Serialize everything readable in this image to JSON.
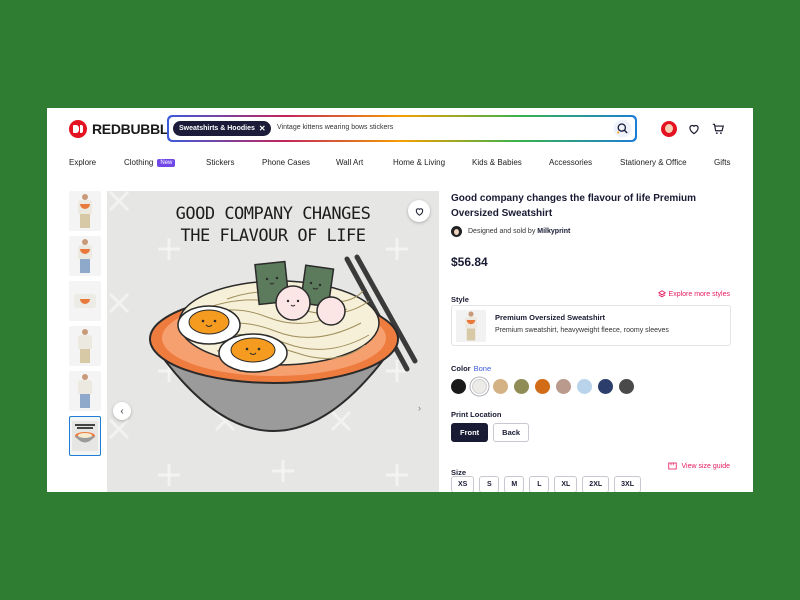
{
  "brand": {
    "name": "REDBUBBLE",
    "accent": "#e41321"
  },
  "search": {
    "chip": "Sweatshirts & Hoodies",
    "chip_clear": "✕",
    "query": "Vintage kittens wearing bows stickers"
  },
  "nav": [
    {
      "label": "Explore"
    },
    {
      "label": "Clothing",
      "badge": "New"
    },
    {
      "label": "Stickers"
    },
    {
      "label": "Phone Cases"
    },
    {
      "label": "Wall Art"
    },
    {
      "label": "Home & Living"
    },
    {
      "label": "Kids & Babies"
    },
    {
      "label": "Accessories"
    },
    {
      "label": "Stationery & Office"
    },
    {
      "label": "Gifts"
    }
  ],
  "gallery": {
    "image_text": [
      "GOOD COMPANY CHANGES",
      "THE FLAVOUR OF LIFE"
    ],
    "prev_icon": "chevron-left-icon",
    "next_icon": "chevron-right-icon",
    "prev_glyph": "‹",
    "next_glyph": "›"
  },
  "product": {
    "title": "Good company changes the flavour of life Premium Oversized Sweatshirt",
    "designed_by": "Designed and sold by",
    "designer": "Milkyprint",
    "price": "$56.84",
    "style_label": "Style",
    "explore_styles": "Explore more styles",
    "style_name": "Premium Oversized Sweatshirt",
    "style_desc": "Premium sweatshirt, heavyweight fleece, roomy sleeves",
    "color_label": "Color",
    "color_value": "Bone",
    "colors": [
      "#1a1a1a",
      "#ecebe8",
      "#d4b285",
      "#8f8c55",
      "#d26c17",
      "#b99a8c",
      "#b9d3ea",
      "#2c3e6b",
      "#4a4a4a"
    ],
    "selected_color_index": 1,
    "print_location_label": "Print Location",
    "print_locations": [
      "Front",
      "Back"
    ],
    "selected_location": "Front",
    "size_label": "Size",
    "size_guide": "View size guide",
    "sizes": [
      "XS",
      "S",
      "M",
      "L",
      "XL",
      "2XL",
      "3XL"
    ]
  }
}
